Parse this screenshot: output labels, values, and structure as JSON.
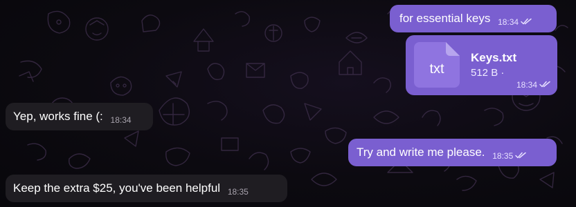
{
  "messages": [
    {
      "text": "for essential keys",
      "time": "18:34",
      "status": "read"
    },
    {
      "file_ext": "txt",
      "file_name": "Keys.txt",
      "file_size": "512 B ·",
      "time": "18:34",
      "status": "read"
    },
    {
      "text": "Yep, works fine (:",
      "time": "18:34"
    },
    {
      "text": "Try and write me please.",
      "time": "18:35",
      "status": "read"
    },
    {
      "text": "Keep the extra $25, you've been helpful",
      "time": "18:35"
    }
  ],
  "colors": {
    "outgoing_bubble": "#7a5fd0",
    "incoming_bubble": "#1f1d22",
    "background": "#0b0910"
  },
  "icons": {
    "read_receipt": "double-check-icon",
    "file": "document-icon"
  }
}
